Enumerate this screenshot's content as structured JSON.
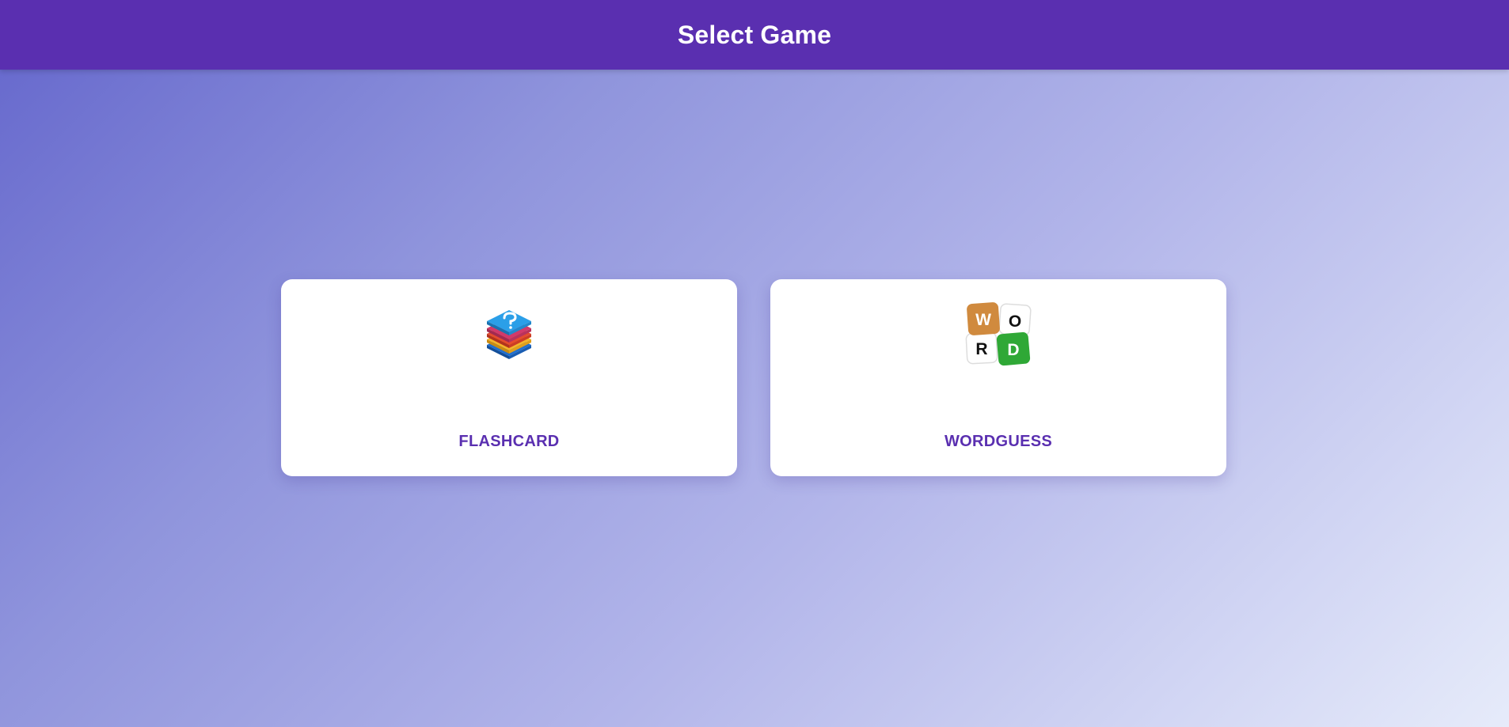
{
  "header": {
    "title": "Select Game"
  },
  "games": [
    {
      "label": "FLASHCARD",
      "icon": "flashcard-stack-icon"
    },
    {
      "label": "WORDGUESS",
      "icon": "word-tiles-icon",
      "tiles": [
        "W",
        "O",
        "R",
        "D"
      ]
    }
  ],
  "colors": {
    "header_bg": "#5a2fb0",
    "label": "#5a2fb0",
    "card_bg": "#ffffff"
  }
}
